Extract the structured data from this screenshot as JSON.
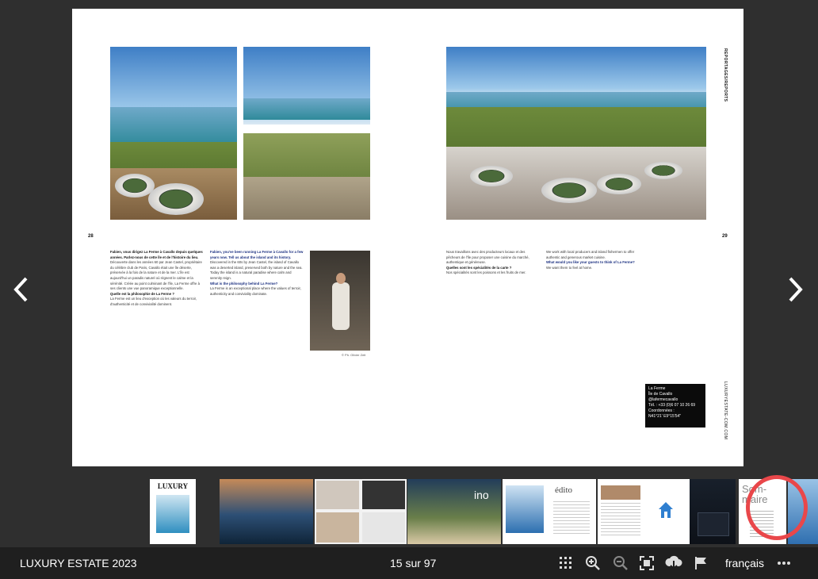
{
  "app": {
    "title": "LUXURY ESTATE 2023",
    "pager": "15 sur 97",
    "language": "français",
    "more_icon": "ellipsis-icon"
  },
  "toolbar": {
    "icons": [
      "grid-icon",
      "zoom-in-icon",
      "zoom-out-icon",
      "fit-screen-icon",
      "download-icon",
      "flag-icon"
    ]
  },
  "magazine": {
    "left_page_number": "28",
    "right_page_number": "29",
    "section_label": "REPORTAGES/REPORTS",
    "website": "LUXURYESTATE-COM.COM",
    "photo_credit": "© Ph. Olivier Zeit",
    "columns": [
      {
        "q": "Fabien, vous dirigez La Ferme à Cavallo depuis quelques années. Parlez-nous de cette île et de l'histoire du lieu.",
        "text": "Découverte dans les années 60 par Jean Castel, propriétaire du célèbre club de Paris, Cavallo était une île déserte, préservée à la fois de la nature et de la mer. L'île est aujourd'hui un paradis naturel où règnent le calme et la sérénité. Créée au point culminant de l'île, La Ferme offre à ses clients une vue panoramique exceptionnelle.",
        "q2": "Quelle est la philosophie de La Ferme ?",
        "text2": "La Ferme est un lieu d'exception où les valeurs du terroir, d'authenticité et de convivialité dominent."
      },
      {
        "qen": "Fabien, you've been running La Ferme à Cavallo for a few years now. Tell us about the island and its history.",
        "text": "Discovered in the 60s by Jean Castel, the island of Cavallo was a deserted island, preserved both by nature and the sea. Today the island is a natural paradise where calm and serenity reign.",
        "qen2": "What is the philosophy behind La Ferme?",
        "text2": "La Ferme is an exceptional place where the values of terroir, authenticity and conviviality dominate."
      },
      {
        "text": "Nous travaillons avec des producteurs locaux et des pêcheurs de l'île pour proposer une cuisine du marché, authentique et généreuse.",
        "q": "Quelles sont les spécialités de la carte ?",
        "text2": "Nos spécialités sont les poissons et les fruits de mer."
      },
      {
        "text": "We work with local producers and island fishermen to offer authentic and generous market cuisine.",
        "qen": "What would you like your guests to think of La Ferme?",
        "text2": "We want them to feel at home."
      }
    ],
    "infobox": {
      "name": "La Ferme",
      "island": "Île de Cavallo",
      "instagram": "@lafermecavallo",
      "tel": "Tél. : +33 (0)6 07 10 26 69",
      "coords_label": "Coordonnées :",
      "coords": "N41°21' E9°15'54\""
    }
  },
  "thumbnails": [
    {
      "name": "thumb-cover",
      "label": "LUXURY",
      "accent": "#2f8fc0"
    },
    {
      "name": "thumb-yacht",
      "label": "",
      "accent": "#3b6b9b"
    },
    {
      "name": "thumb-fashion",
      "label": "",
      "accent": "#111111"
    },
    {
      "name": "thumb-catalog",
      "label": "",
      "accent": "#8a8a8a"
    },
    {
      "name": "thumb-villa",
      "label": "ino",
      "accent": "#6a7f4a"
    },
    {
      "name": "thumb-edito",
      "label": "édito",
      "accent": "#2c6fb0"
    },
    {
      "name": "thumb-home",
      "label": "",
      "accent": "#2f7fd0"
    },
    {
      "name": "thumb-resort",
      "label": "",
      "accent": "#1d2430"
    },
    {
      "name": "thumb-sommaire",
      "label": "Som-maire",
      "accent": "#6a6a6a"
    }
  ]
}
